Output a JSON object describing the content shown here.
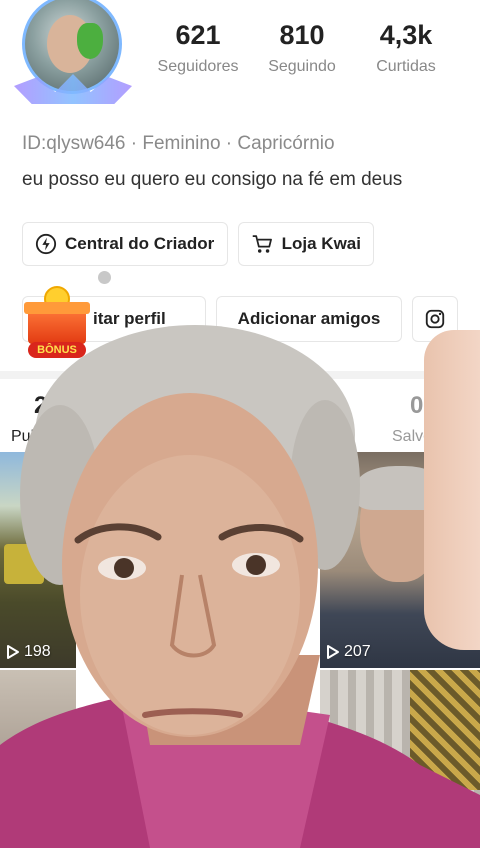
{
  "stats": [
    {
      "value": "621",
      "label": "Seguidores"
    },
    {
      "value": "810",
      "label": "Seguindo"
    },
    {
      "value": "4,3k",
      "label": "Curtidas"
    }
  ],
  "profile": {
    "id_line": "ID:qlysw646 · Feminino · Capricórnio",
    "bio": "eu posso eu quero eu consigo na fé em deus"
  },
  "actions": {
    "creator_center": "Central do Criador",
    "kwai_shop": "Loja Kwai",
    "edit_profile": "itar perfil",
    "add_friends": "Adicionar amigos",
    "bonus_tag": "BÔNUS"
  },
  "tabs": [
    {
      "count": "2",
      "label": "Pub"
    },
    {
      "count": "0",
      "label": "Salvou"
    }
  ],
  "videos": [
    {
      "views": "198"
    },
    {
      "views": "207"
    }
  ],
  "colors": {
    "avatar_ring": "#7fb9ff",
    "bonus_red": "#d9261c",
    "overlay_shirt": "#b03a78"
  },
  "icons": {
    "creator_center": "lightning-icon",
    "kwai_shop": "cart-icon",
    "instagram": "instagram-icon",
    "play": "play-icon"
  }
}
